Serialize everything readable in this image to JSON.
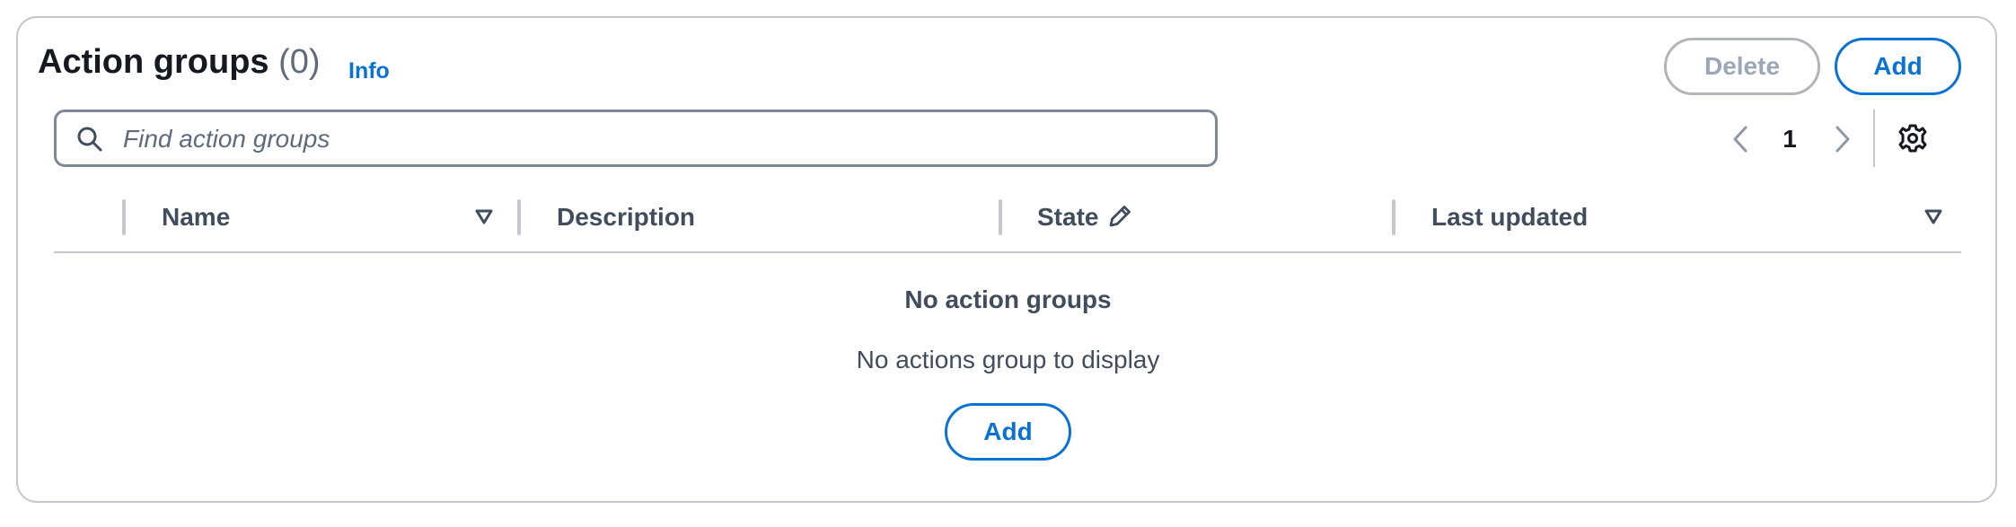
{
  "header": {
    "title": "Action groups",
    "count": "(0)",
    "info_label": "Info",
    "delete_label": "Delete",
    "add_label": "Add"
  },
  "search": {
    "placeholder": "Find action groups",
    "value": ""
  },
  "pagination": {
    "current_page": "1"
  },
  "table": {
    "columns": [
      {
        "label": "Name",
        "sortable": true
      },
      {
        "label": "Description",
        "sortable": false
      },
      {
        "label": "State",
        "editable": true
      },
      {
        "label": "Last updated",
        "sortable": true
      }
    ]
  },
  "empty_state": {
    "title": "No action groups",
    "description": "No actions group to display",
    "add_label": "Add"
  },
  "colors": {
    "accent": "#0972d3",
    "border": "#c6c6cd",
    "text": "#16191f",
    "muted_text": "#414d5c",
    "disabled_text": "#9ba7b6"
  },
  "icons": {
    "search": "search-icon",
    "prev": "chevron-left-icon",
    "next": "chevron-right-icon",
    "settings": "gear-icon",
    "sort": "sort-down-icon",
    "edit": "pencil-icon"
  }
}
